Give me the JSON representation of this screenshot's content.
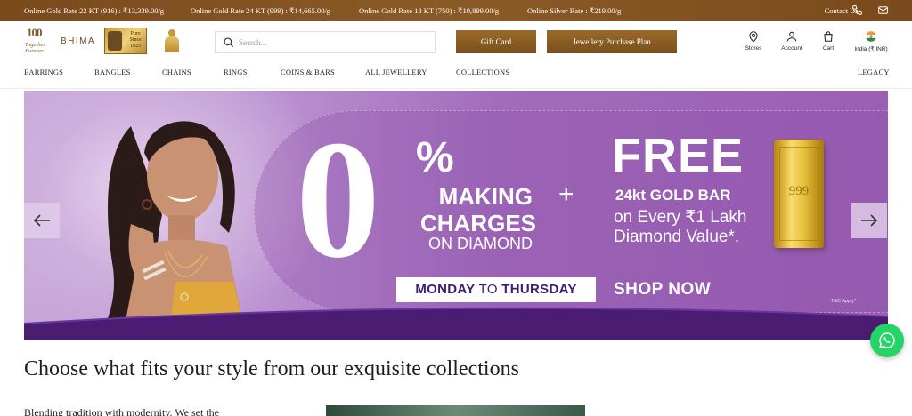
{
  "rates": {
    "gold22": "Online Gold Rate 22 KT (916) : ₹13,339.00/g",
    "gold24": "Online Gold Rate 24 KT (999) : ₹14,665.00/g",
    "gold18": "Online Gold Rate 18 KT (750) : ₹10,899.00/g",
    "silver": "Online Silver Rate : ₹219.00/g",
    "contact_label": "Contact Us:"
  },
  "brand": {
    "anniversary_number": "100",
    "tagline": "Together Forever",
    "name": "BHIMA",
    "badge_text": "Pure Since 1925"
  },
  "search": {
    "placeholder": "Search..."
  },
  "buttons": {
    "gift_card": "Gift Card",
    "purchase_plan": "Jewellery Purchase Plan"
  },
  "header_icons": {
    "stores": "Stores",
    "account": "Account",
    "cart": "Cart",
    "region": "India (₹ INR)"
  },
  "nav": {
    "items": [
      "EARRINGS",
      "BANGLES",
      "CHAINS",
      "RINGS",
      "COINS & BARS",
      "ALL JEWELLERY",
      "COLLECTIONS"
    ],
    "legacy": "LEGACY"
  },
  "banner": {
    "zero": "0",
    "percent": "%",
    "making": "MAKING",
    "charges": "CHARGES",
    "on_diamond": "ON DIAMOND",
    "plus": "+",
    "free": "FREE",
    "gold_bar": "24kt GOLD BAR",
    "every_line1": "on Every ₹1 Lakh",
    "every_line2": "Diamond Value*.",
    "bar_stamp": "999",
    "monday": "MONDAY",
    "to": "TO",
    "thursday": "THURSDAY",
    "shop_now": "SHOP NOW",
    "tc": "T&C Apply*"
  },
  "content": {
    "heading": "Choose what fits your style from our exquisite collections",
    "paragraph": "Blending tradition with modernity. We set the"
  },
  "colors": {
    "rate_bar": "#7a4a1c",
    "gold_button": "#8a5a22",
    "banner_purple": "#9a5fb4",
    "weekday_text": "#3a1e73",
    "whatsapp": "#25d366"
  }
}
